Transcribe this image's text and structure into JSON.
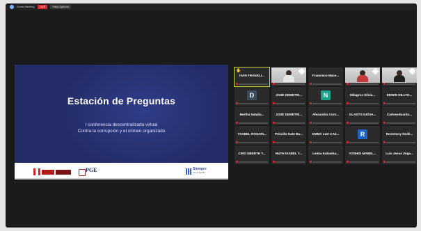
{
  "topbar": {
    "app_label": "Zoom Meeting",
    "live_badge": "LIVE",
    "view_label": "View Options"
  },
  "presentation": {
    "title": "Estación de Preguntas",
    "subtitle_line1": "I conferencia descentralizada virtual",
    "subtitle_line2": "Contra la corrupción y el crimen organizado",
    "logos": {
      "logo1": "peru-gov-logo",
      "logo2": "PGE",
      "logo3_line1": "Siempre",
      "logo3_line2": "con el pueblo"
    }
  },
  "participants": [
    {
      "name": "IVAN FRANKLI...",
      "type": "name",
      "active": true,
      "hand": true
    },
    {
      "name": "",
      "type": "video",
      "person_style": "white",
      "hand": false
    },
    {
      "name": "Francisco Mace...",
      "type": "name"
    },
    {
      "name": "",
      "type": "video",
      "person_style": "red"
    },
    {
      "name": "",
      "type": "video",
      "person_style": "dark"
    },
    {
      "name": "",
      "type": "avatar",
      "initial": "D",
      "color": "#3a4b5e"
    },
    {
      "name": "JOSÉ DEMETRI...",
      "type": "name"
    },
    {
      "name": "",
      "type": "avatar",
      "initial": "N",
      "color": "#18a088"
    },
    {
      "name": "Milagros Silvia...",
      "type": "name"
    },
    {
      "name": "EDWIN HILLTO...",
      "type": "name"
    },
    {
      "name": "Bertha Natalia...",
      "type": "name"
    },
    {
      "name": "JOSÉ DEMETRI...",
      "type": "name"
    },
    {
      "name": "Alexandra Corn...",
      "type": "name"
    },
    {
      "name": "GLADYS GIOVA...",
      "type": "name"
    },
    {
      "name": "Carloseduardo...",
      "type": "name"
    },
    {
      "name": "YSABEL ROSARI...",
      "type": "name"
    },
    {
      "name": "Priscilla Kate Bu...",
      "type": "name"
    },
    {
      "name": "EMMA LUZ CAZ...",
      "type": "name"
    },
    {
      "name": "",
      "type": "avatar",
      "initial": "R",
      "color": "#1e63c7"
    },
    {
      "name": "Rosemary Noeli...",
      "type": "name"
    },
    {
      "name": "CIRO EBERTH T...",
      "type": "name"
    },
    {
      "name": "RUTH ISABEL Y...",
      "type": "name"
    },
    {
      "name": "Lenka Katiusha...",
      "type": "name"
    },
    {
      "name": "YOSHIO MABEL...",
      "type": "name"
    },
    {
      "name": "Luis Jesus Zega...",
      "type": "name"
    }
  ],
  "colors": {
    "active_outline": "#c8d93a",
    "presentation_bg": "#242c67",
    "muted_mic": "#d9262e"
  }
}
